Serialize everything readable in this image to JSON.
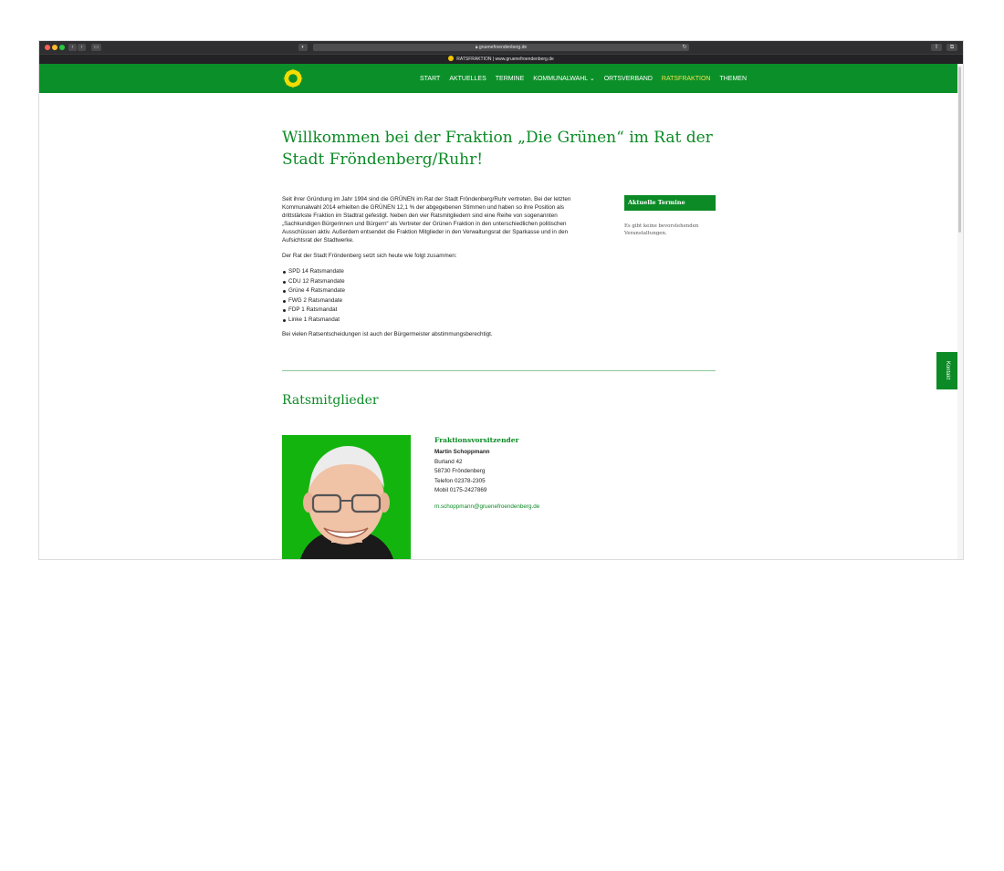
{
  "browser": {
    "url": "gruenefroendenberg.de",
    "tab_title": "RATSFRAKTION | www.gruenefroendenberg.de",
    "traffic_lights": [
      "#ff5f57",
      "#febc2e",
      "#28c840"
    ]
  },
  "header": {
    "logo_icon": "sunflower-logo-icon",
    "nav": [
      {
        "label": "START"
      },
      {
        "label": "AKTUELLES"
      },
      {
        "label": "TERMINE"
      },
      {
        "label": "KOMMUNALWAHL ⌄"
      },
      {
        "label": "ORTSVERBAND"
      },
      {
        "label": "RATSFRAKTION"
      },
      {
        "label": "THEMEN"
      }
    ],
    "active_nav": "RATSFRAKTION"
  },
  "main": {
    "title": "Willkommen bei der Fraktion „Die Grünen“ im Rat der Stadt Fröndenberg/Ruhr!",
    "intro_paragraph": "Seit ihrer Gründung im Jahr 1994 sind die GRÜNEN im Rat der Stadt Fröndenberg/Ruhr vertreten. Bei der letzten Kommunalwahl 2014 erhielten die GRÜNEN 12,1 % der abgegebenen Stimmen und haben so ihre Position als drittstärkste Fraktion im Stadtrat gefestigt. Neben den vier Ratsmitgliedern sind eine Reihe von sogenannten „Sachkundigen Bürgerinnen und Bürgern“ als Vertreter der Grünen Fraktion in den unterschiedlichen politischen Ausschüssen aktiv. Außerdem entsendet die Fraktion Mitglieder in den Verwaltungsrat der Sparkasse und in den Aufsichtsrat der Stadtwerke.",
    "composition_intro": "Der Rat der Stadt Fröndenberg setzt sich heute wie folgt zusammen:",
    "seats": [
      "SPD 14 Ratsmandate",
      "CDU 12 Ratsmandate",
      "Grüne 4 Ratsmandate",
      "FWG 2 Ratsmandate",
      "FDP 1 Ratsmandat",
      "Linke 1 Ratsmandat"
    ],
    "footnote": "Bei vielen Ratsentscheidungen ist auch der Bürgermeister abstimmungsberechtigt.",
    "section_title": "Ratsmitglieder"
  },
  "sidebar": {
    "heading": "Aktuelle Termine",
    "text": "Es gibt keine bevorstehenden Veranstaltungen."
  },
  "member": {
    "role": "Fraktionsvorsitzender",
    "name": "Martin Schoppmann",
    "street": "Burland 42",
    "city": "58730 Fröndenberg",
    "phone": "Telefon 02378-2305",
    "mobile": "Mobil 0175-2427869",
    "email": "m.schoppmann@gruenefroendenberg.de"
  },
  "kontakt": {
    "label": "Kontakt"
  },
  "colors": {
    "brand_green": "#0b8a25",
    "nav_active": "#f3e24e"
  }
}
